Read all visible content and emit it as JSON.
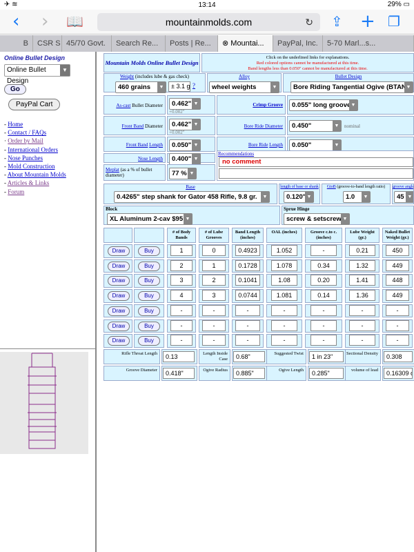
{
  "status": {
    "time": "13:14",
    "battery": "29%"
  },
  "browser": {
    "url": "mountainmolds.com",
    "tabs": [
      "B",
      "CSR S",
      "45/70 Govt.",
      "Search Re...",
      "Posts | Re...",
      "Mountai...",
      "PayPal, Inc.",
      "5-70 Marl...s..."
    ]
  },
  "sidebar": {
    "title": "Online Bullet Design",
    "select": "Online Bullet Design",
    "go": "Go",
    "paypal": "PayPal Cart",
    "links": [
      "Home",
      "Contact / FAQs",
      "Order by Mail",
      "International Orders",
      "Nose Punches",
      "Mold Construction",
      "About Mountain Molds",
      "Articles & Links",
      "Forum"
    ]
  },
  "header": {
    "title": "Mountain Molds Online Bullet Design",
    "note1": "Click on the underlined links for explanations.",
    "note2": "Red colored options cannot be manufactured at this time.",
    "note3": "Band lengths less than 0.050\" cannot be manufactured at this time."
  },
  "weight": {
    "label": "Weight",
    "sub": "(includes lube & gas check)",
    "value": "460 grains",
    "tol": "± 3.1 g",
    "help": "?"
  },
  "alloy": {
    "label": "Alloy",
    "value": "wheel weights"
  },
  "bullet": {
    "label": "Bullet Design",
    "value": "Bore Riding Tangential Ogive (BTAN)"
  },
  "dims": {
    "ascast_label": "As-cast",
    "ascast_lbl2": "Bullet Diameter",
    "ascast": "0.462\"",
    "ascast_tol": "+0.002\"",
    "crimp_label": "Crimp Groove",
    "crimp": "0.055\" long groove",
    "front_label": "Front Band",
    "front_lbl2": "Diameter",
    "front": "0.462\"",
    "front_tol": "+0.002\"",
    "boreride_label": "Bore Ride Diameter",
    "boreride": "0.450\"",
    "nominal": "nominal",
    "frontlen_label": "Front Band",
    "frontlen_lbl2": "Length",
    "frontlen": "0.050\"",
    "borelen_label": "Bore Ride",
    "borelen_lbl2": "Length",
    "borelen": "0.050\"",
    "nose_label": "Nose Length",
    "nose": "0.400\"",
    "meplat_label": "Meplat",
    "meplat_sub": "(as a % of bullet diameter)",
    "meplat": "77 %",
    "rec_label": "Recommendations",
    "rec": "no comment"
  },
  "base": {
    "label": "Base",
    "value": "0.4265\" step shank for Gator 458 Rifle, 9.8 gr.",
    "len_label": "length of base or shank",
    "len": "0.120\"",
    "gtob_label": "GtoB",
    "gtob_sub": "(groove-to-band length ratio)",
    "gtob": "1.0",
    "ga_label": "groove angle",
    "ga": "45"
  },
  "block": {
    "label": "Block",
    "value": "XL Aluminum 2-cav $95",
    "sprue_label": "Sprue Hinge",
    "sprue": "screw & setscrew"
  },
  "table": {
    "headers": [
      "# of Body Bands",
      "# of Lube Grooves",
      "Band Length (inches)",
      "OAL (inches)",
      "Groove c.to c. (inches)",
      "Lube Weight (gr.)",
      "Naked Bullet Weight (gr.)"
    ],
    "draw": "Draw",
    "buy": "Buy",
    "rows": [
      [
        "1",
        "0",
        "0.4923",
        "1.052",
        "-",
        "0.21",
        "450"
      ],
      [
        "2",
        "1",
        "0.1728",
        "1.078",
        "0.34",
        "1.32",
        "449"
      ],
      [
        "3",
        "2",
        "0.1041",
        "1.08",
        "0.20",
        "1.41",
        "448"
      ],
      [
        "4",
        "3",
        "0.0744",
        "1.081",
        "0.14",
        "1.36",
        "449"
      ],
      [
        "-",
        "-",
        "-",
        "-",
        "-",
        "-",
        "-"
      ],
      [
        "-",
        "-",
        "-",
        "-",
        "-",
        "-",
        "-"
      ],
      [
        "-",
        "-",
        "-",
        "-",
        "-",
        "-",
        "-"
      ]
    ]
  },
  "footer": {
    "rt_label": "Rifle Throat Length",
    "rt": "0.13",
    "lic_label": "Length Inside Case",
    "lic": "0.68\"",
    "st_label": "Suggested Twist",
    "st": "1 in 23\"",
    "sd_label": "Sectional Density",
    "sd": "0.308",
    "gd_label": "Groove Diameter",
    "gd": "0.418\"",
    "or_label": "Ogive Radius",
    "or": "0.885\"",
    "ol_label": "Ogive Length",
    "ol": "0.285\"",
    "vl_label": "volume of lead",
    "vl": "0.16309 c"
  }
}
